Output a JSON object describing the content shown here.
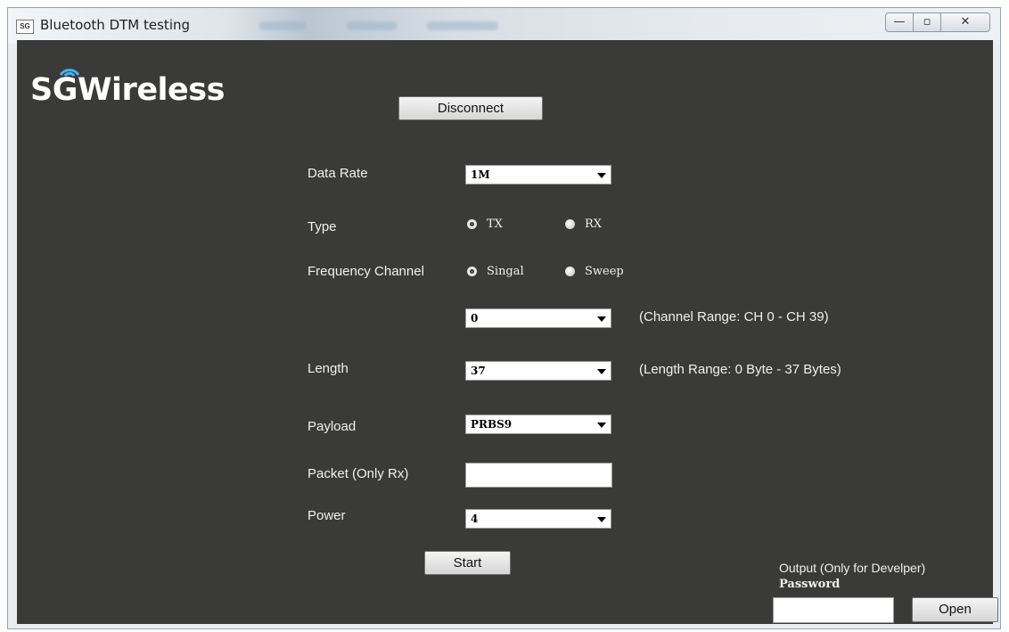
{
  "window": {
    "title": "Bluetooth DTM testing",
    "app_icon_text": "SG",
    "controls": {
      "minimize": "—",
      "maximize": "▫",
      "close": "✕"
    }
  },
  "logo": {
    "prefix": "S",
    "g": "G",
    "suffix": "Wireless"
  },
  "disconnect_label": "Disconnect",
  "form": {
    "data_rate": {
      "label": "Data Rate",
      "value": "1M"
    },
    "type": {
      "label": "Type",
      "options": [
        "TX",
        "RX"
      ],
      "selected": "TX"
    },
    "frequency_channel": {
      "label": "Frequency Channel",
      "options": [
        "Singal",
        "Sweep"
      ],
      "selected": "Singal"
    },
    "channel": {
      "value": "0",
      "hint": "(Channel Range: CH 0 - CH 39)"
    },
    "length": {
      "label": "Length",
      "value": "37",
      "hint": "(Length Range: 0 Byte - 37 Bytes)"
    },
    "payload": {
      "label": "Payload",
      "value": "PRBS9"
    },
    "packet": {
      "label": "Packet (Only Rx)",
      "value": ""
    },
    "power": {
      "label": "Power",
      "value": "4"
    }
  },
  "start_label": "Start",
  "output": {
    "label": "Output  (Only for Develper)",
    "password_label": "Password",
    "password_value": "",
    "open_label": "Open"
  },
  "colors": {
    "background": "#3a3a38",
    "text": "#f0f0f0"
  }
}
